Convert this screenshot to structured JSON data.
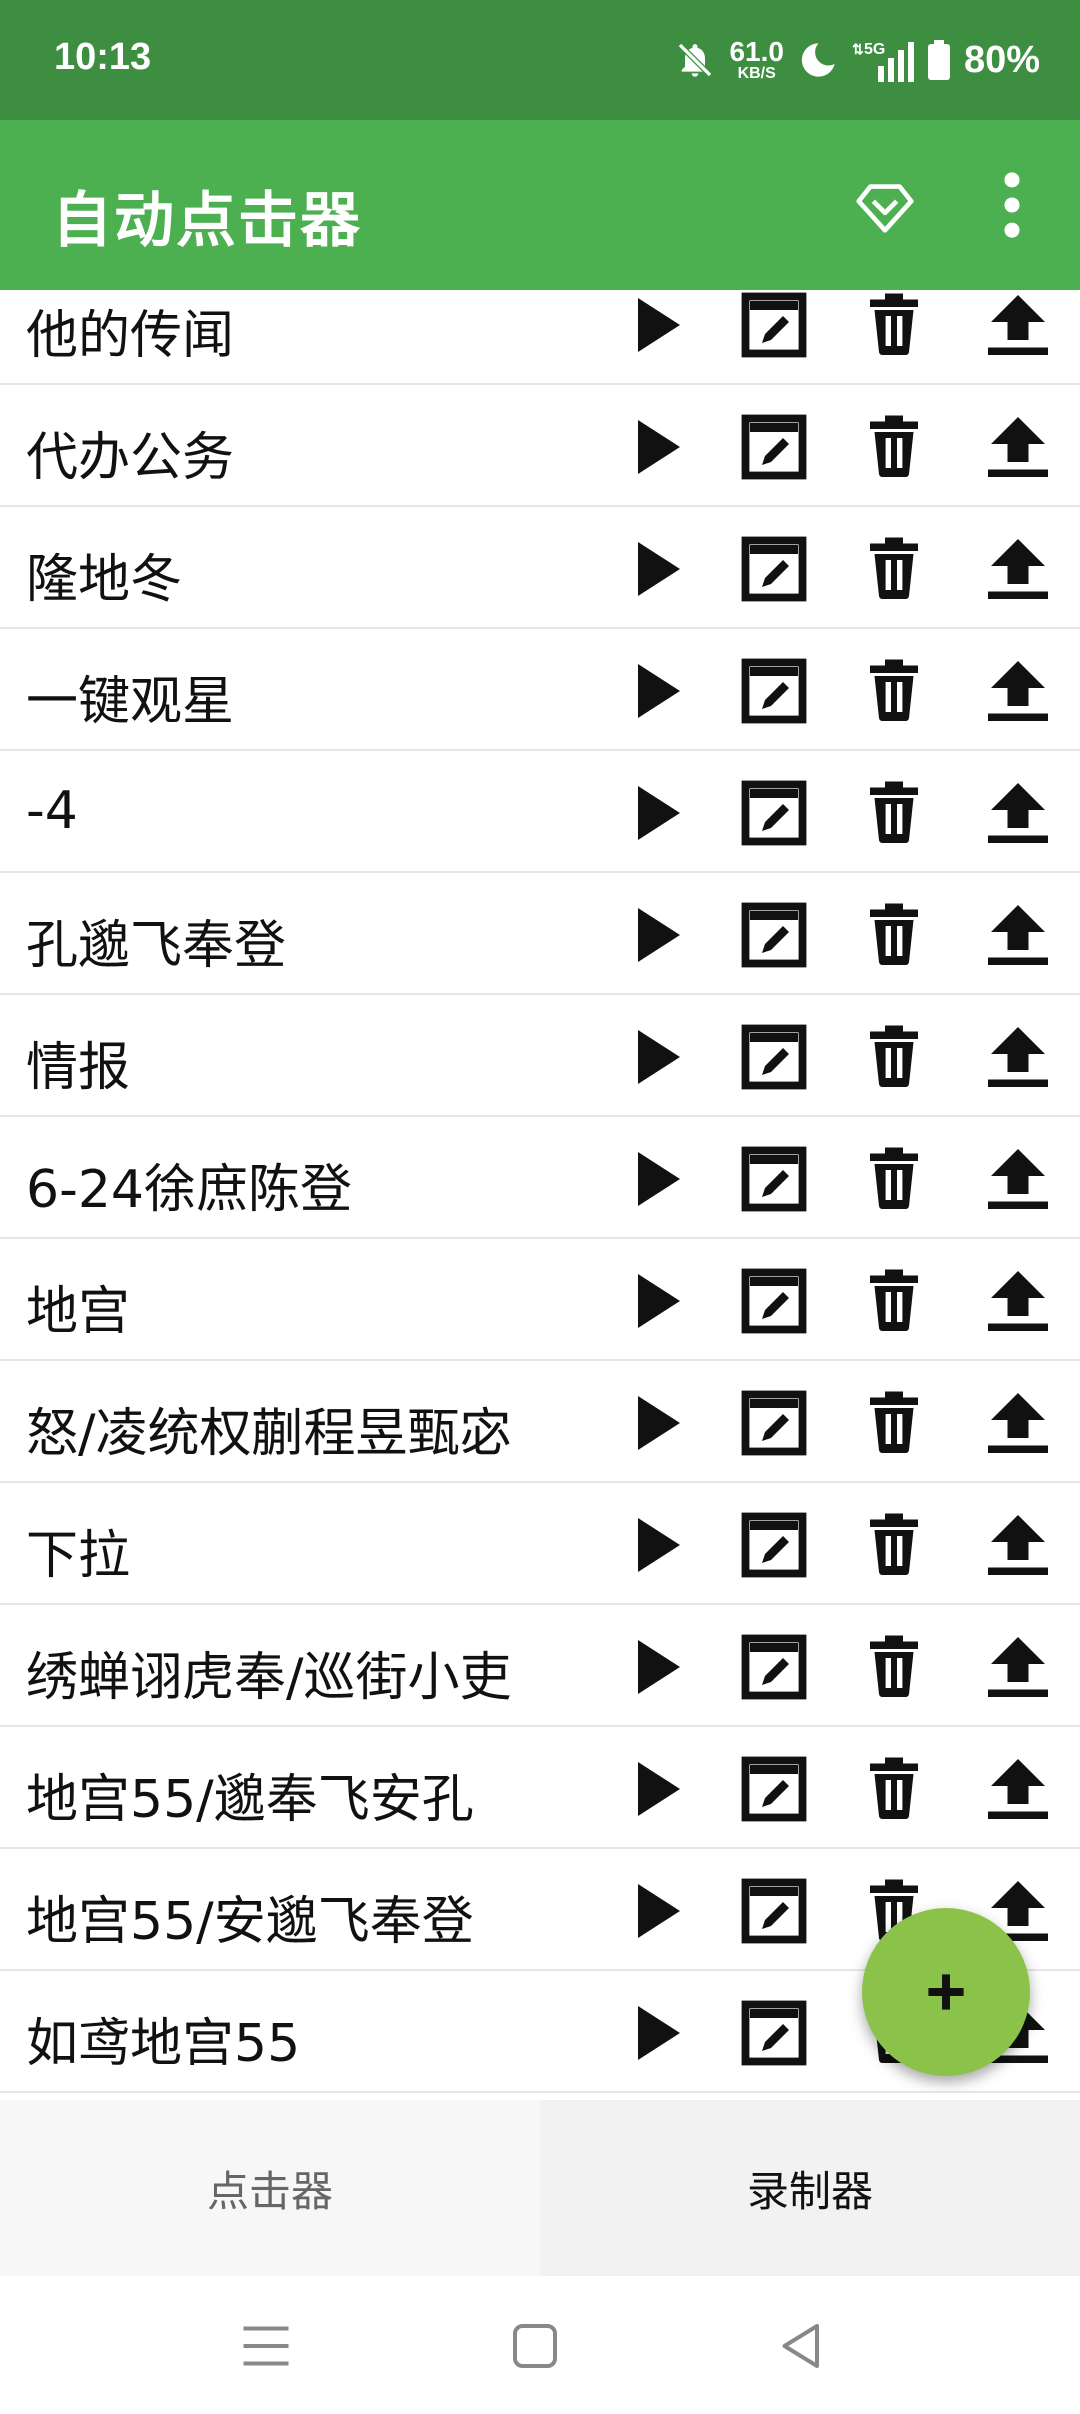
{
  "status_bar": {
    "time": "10:13",
    "net_speed_value": "61.0",
    "net_speed_unit": "KB/S",
    "network_label": "5G",
    "battery": "80%"
  },
  "app_bar": {
    "title": "自动点击器",
    "icons": [
      "diamond-icon",
      "more-vert-icon"
    ]
  },
  "list": {
    "items": [
      {
        "label": "他的传闻"
      },
      {
        "label": "代办公务"
      },
      {
        "label": "隆地冬"
      },
      {
        "label": "一键观星"
      },
      {
        "label": "-4"
      },
      {
        "label": "孔邈飞奉登"
      },
      {
        "label": "情报"
      },
      {
        "label": "6-24徐庶陈登"
      },
      {
        "label": "地宫"
      },
      {
        "label": "怒/凌统权蒯程昱甄宓"
      },
      {
        "label": "下拉"
      },
      {
        "label": "绣蝉诩虎奉/巡街小吏"
      },
      {
        "label": "地宫55/邈奉飞安孔"
      },
      {
        "label": "地宫55/安邈飞奉登"
      },
      {
        "label": "如鸢地宫55"
      }
    ],
    "row_actions": [
      "play-icon",
      "edit-icon",
      "delete-icon",
      "upload-icon"
    ]
  },
  "fab": {
    "symbol": "+"
  },
  "bottom_nav": {
    "tabs": [
      {
        "label": "点击器",
        "selected": false
      },
      {
        "label": "录制器",
        "selected": true
      }
    ]
  },
  "colors": {
    "status_bar": "#3e8e41",
    "app_bar": "#4caf50",
    "fab": "#8bc34a"
  }
}
